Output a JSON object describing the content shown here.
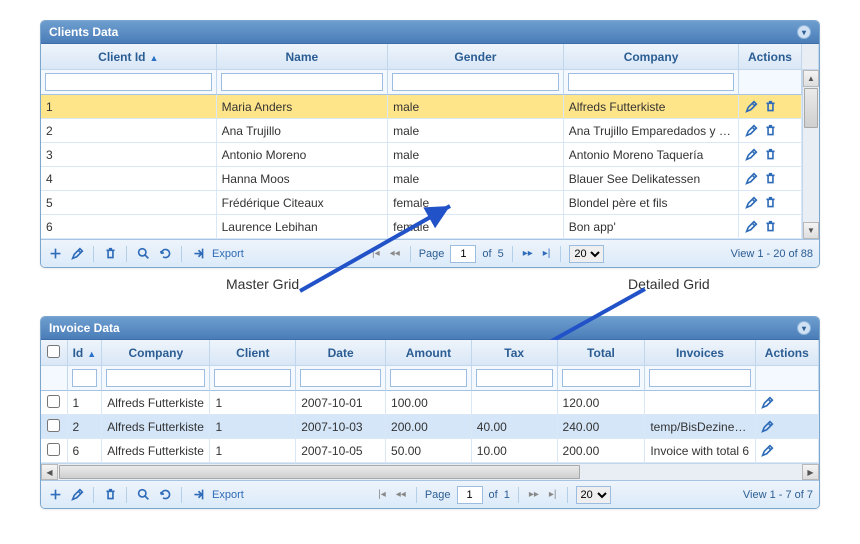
{
  "labels": {
    "master": "Master Grid",
    "detailed": "Detailed Grid"
  },
  "master": {
    "title": "Clients Data",
    "columns": {
      "clientId": "Client Id",
      "name": "Name",
      "gender": "Gender",
      "company": "Company",
      "actions": "Actions"
    },
    "rows": [
      {
        "id": "1",
        "name": "Maria Anders",
        "gender": "male",
        "company": "Alfreds Futterkiste",
        "hl": true
      },
      {
        "id": "2",
        "name": "Ana Trujillo",
        "gender": "male",
        "company": "Ana Trujillo Emparedados y helados"
      },
      {
        "id": "3",
        "name": "Antonio Moreno",
        "gender": "male",
        "company": "Antonio Moreno Taquería"
      },
      {
        "id": "4",
        "name": "Hanna Moos",
        "gender": "male",
        "company": "Blauer See Delikatessen"
      },
      {
        "id": "5",
        "name": "Frédérique Citeaux",
        "gender": "female",
        "company": "Blondel père et fils"
      },
      {
        "id": "6",
        "name": "Laurence Lebihan",
        "gender": "female",
        "company": "Bon app'"
      }
    ],
    "pager": {
      "export": "Export",
      "pageLabel": "Page",
      "page": "1",
      "ofLabel": "of",
      "total": "5",
      "perPage": "20",
      "info": "View 1 - 20 of 88"
    }
  },
  "detail": {
    "title": "Invoice Data",
    "columns": {
      "id": "Id",
      "company": "Company",
      "client": "Client",
      "date": "Date",
      "amount": "Amount",
      "tax": "Tax",
      "total": "Total",
      "invoices": "Invoices",
      "actions": "Actions"
    },
    "rows": [
      {
        "id": "1",
        "company": "Alfreds Futterkiste",
        "client": "1",
        "date": "2007-10-01",
        "amount": "100.00",
        "tax": "",
        "total": "120.00",
        "invoices": ""
      },
      {
        "id": "2",
        "company": "Alfreds Futterkiste",
        "client": "1",
        "date": "2007-10-03",
        "amount": "200.00",
        "tax": "40.00",
        "total": "240.00",
        "invoices": "temp/BisDezineFoo",
        "sel": true
      },
      {
        "id": "6",
        "company": "Alfreds Futterkiste",
        "client": "1",
        "date": "2007-10-05",
        "amount": "50.00",
        "tax": "10.00",
        "total": "200.00",
        "invoices": "Invoice with total 6"
      }
    ],
    "pager": {
      "export": "Export",
      "pageLabel": "Page",
      "page": "1",
      "ofLabel": "of",
      "total": "1",
      "perPage": "20",
      "info": "View 1 - 7 of 7"
    }
  }
}
